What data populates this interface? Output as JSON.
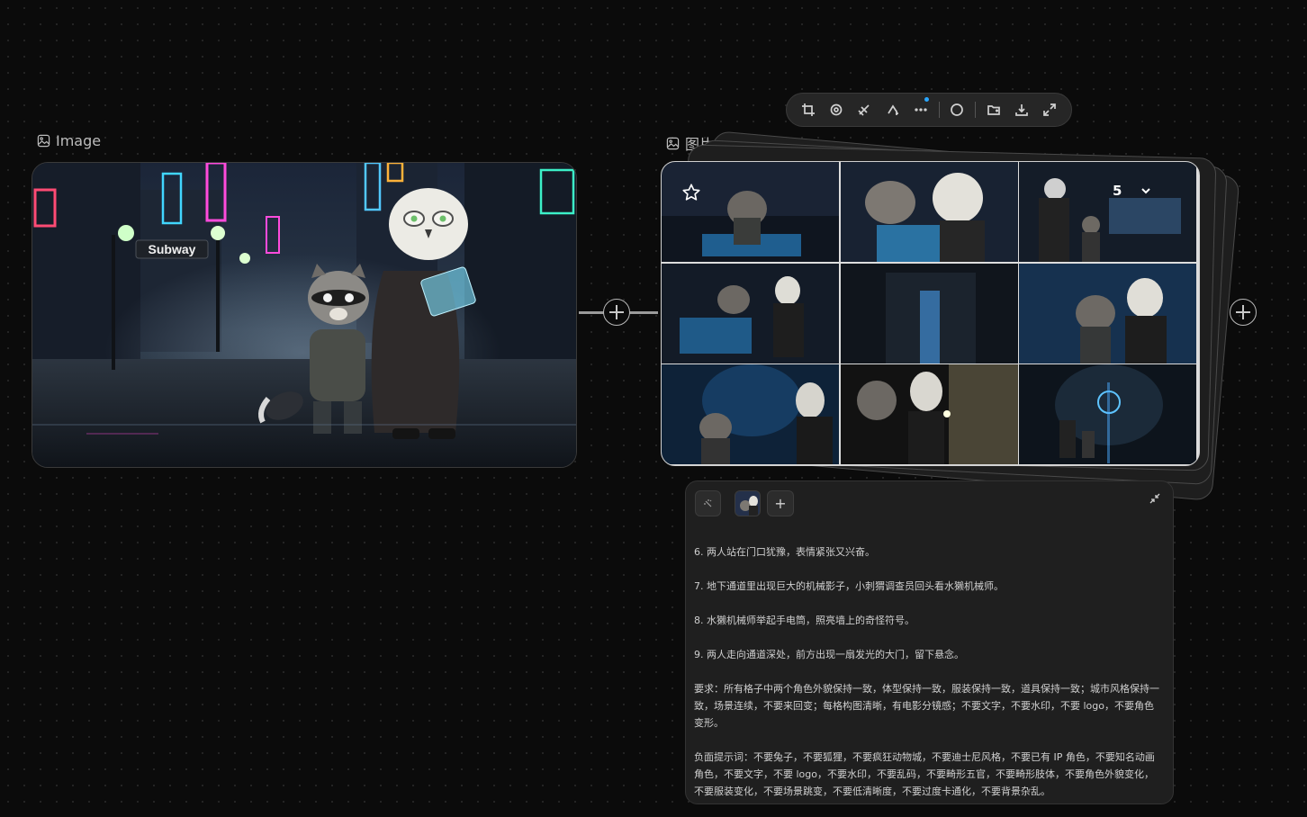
{
  "left_node": {
    "title": "Image",
    "icon": "image-icon"
  },
  "right_node": {
    "title": "图片生成",
    "icon": "image-icon"
  },
  "toolbar": {
    "buttons": [
      "crop-icon",
      "cutout-icon",
      "erase-icon",
      "adjust-icon",
      "more-icon",
      "circle-icon",
      "folder-icon",
      "download-icon",
      "expand-icon"
    ]
  },
  "grid": {
    "favorite_icon": "star-icon",
    "count": "5",
    "dropdown_icon": "chevron-down-icon"
  },
  "scene_sign": {
    "subway": "Subway"
  },
  "panel": {
    "add_label": "+",
    "paragraphs": [
      "6. 两人站在门口犹豫，表情紧张又兴奋。",
      "7. 地下通道里出现巨大的机械影子，小刺猬调查员回头看水獭机械师。",
      "8. 水獭机械师举起手电筒，照亮墙上的奇怪符号。",
      "9. 两人走向通道深处，前方出现一扇发光的大门，留下悬念。",
      "要求：所有格子中两个角色外貌保持一致，体型保持一致，服装保持一致，道具保持一致；城市风格保持一致，场景连续，不要来回变；每格构图清晰，有电影分镜感；不要文字，不要水印，不要 logo，不要角色变形。",
      "负面提示词：不要兔子，不要狐狸，不要疯狂动物城，不要迪士尼风格，不要已有 IP 角色，不要知名动画角色，不要文字，不要 logo，不要水印，不要乱码，不要畸形五官，不要畸形肢体，不要角色外貌变化，不要服装变化，不要场景跳变，不要低清晰度，不要过度卡通化，不要背景杂乱。"
    ]
  }
}
